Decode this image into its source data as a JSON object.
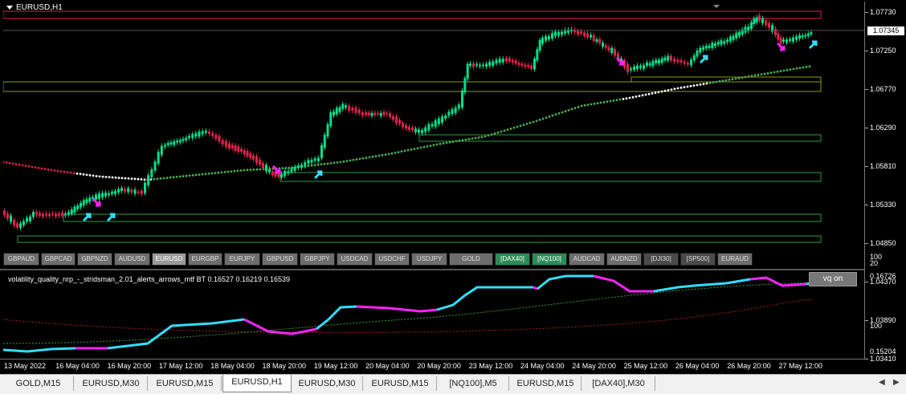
{
  "window": {
    "symbol_title": "EURUSD,H1"
  },
  "price_axis": {
    "ticks": [
      "1.07730",
      "1.07250",
      "1.06770",
      "1.06290",
      "1.05810",
      "1.05330",
      "1.04850",
      "1.04370",
      "1.03890",
      "1.03410"
    ],
    "current_price": "1.07345"
  },
  "symbol_buttons": [
    {
      "label": "GBPAUD",
      "style": "gray"
    },
    {
      "label": "GBPCAD",
      "style": "gray"
    },
    {
      "label": "GBPNZD",
      "style": "gray"
    },
    {
      "label": "AUDUSD",
      "style": "gray"
    },
    {
      "label": "EURUSD",
      "style": "active"
    },
    {
      "label": "EURGBP",
      "style": "gray"
    },
    {
      "label": "EURJPY",
      "style": "gray"
    },
    {
      "label": "GBPUSD",
      "style": "gray"
    },
    {
      "label": "GBPJPY",
      "style": "gray"
    },
    {
      "label": "USDCAD",
      "style": "gray"
    },
    {
      "label": "USDCHF",
      "style": "gray"
    },
    {
      "label": "USDJPY",
      "style": "gray"
    },
    {
      "label": "GOLD",
      "style": "gray"
    },
    {
      "label": "[DAX40]",
      "style": "green"
    },
    {
      "label": "[NQ100]",
      "style": "green"
    },
    {
      "label": "AUDCAD",
      "style": "gray"
    },
    {
      "label": "AUDNZD",
      "style": "gray"
    },
    {
      "label": "[DJI30]",
      "style": "dark"
    },
    {
      "label": "[SP500]",
      "style": "dark"
    },
    {
      "label": "EURAUD",
      "style": "gray"
    }
  ],
  "indicator": {
    "label": "volatility_quality_nrp_-_stridsman_2.01_alerts_arrows_mtf BT 0.16527 0.16219 0.16539",
    "button": "vq on",
    "axis_top": [
      "100",
      "20"
    ],
    "ticks": [
      "0.16726",
      "100",
      "0.15204"
    ]
  },
  "time_axis": [
    "13 May 2022",
    "16 May 04:00",
    "16 May 20:00",
    "17 May 12:00",
    "18 May 04:00",
    "18 May 20:00",
    "19 May 12:00",
    "20 May 04:00",
    "20 May 20:00",
    "23 May 12:00",
    "24 May 04:00",
    "24 May 20:00",
    "25 May 12:00",
    "26 May 04:00",
    "26 May 20:00",
    "27 May 12:00"
  ],
  "tabs": [
    "GOLD,M15",
    "EURUSD,M30",
    "EURUSD,M15",
    "EURUSD,H1",
    "EURUSD,M30",
    "EURUSD,M15",
    "[NQ100],M5",
    "EURUSD,M15",
    "[DAX40],M30"
  ],
  "active_tab": 3,
  "colors": {
    "bull": "#00e08a",
    "bear": "#e0204a",
    "ma_green": "#4caf50",
    "ma_red": "#e0204a",
    "vq_cyan": "#33ddff",
    "vq_magenta": "#ff22ff",
    "box_green": "#2e9e3e",
    "box_red": "#e0204a",
    "box_olive": "#8aa000"
  }
}
